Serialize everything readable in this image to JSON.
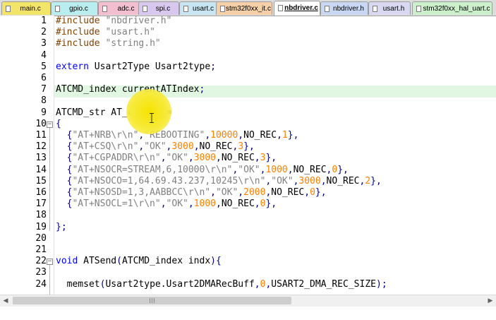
{
  "tabs": [
    {
      "label": "main.c",
      "color": "#f3e46a",
      "active": false
    },
    {
      "label": "gpio.c",
      "color": "#b9eef0",
      "active": false
    },
    {
      "label": "adc.c",
      "color": "#f2bfd0",
      "active": false
    },
    {
      "label": "spi.c",
      "color": "#d8c8f0",
      "active": false
    },
    {
      "label": "usart.c",
      "color": "#c8e6f2",
      "active": false
    },
    {
      "label": "stm32f0xx_it.c",
      "color": "#f5cfa8",
      "active": false
    },
    {
      "label": "nbdriver.c",
      "color": "#ffffff",
      "active": true
    },
    {
      "label": "nbdriver.h",
      "color": "#c8d8f2",
      "active": false
    },
    {
      "label": "usart.h",
      "color": "#d8d8f2",
      "active": false
    },
    {
      "label": "stm32f0xx_hal_uart.c",
      "color": "#ccf0cc",
      "active": false
    }
  ],
  "editor": {
    "current_line": 7,
    "line_numbers": [
      "1",
      "2",
      "3",
      "4",
      "5",
      "6",
      "7",
      "8",
      "9",
      "10",
      "11",
      "12",
      "13",
      "14",
      "15",
      "16",
      "17",
      "18",
      "19",
      "20",
      "21",
      "22",
      "23",
      "24"
    ],
    "lines": [
      "#include \"nbdriver.h\"",
      "#include \"usart.h\"",
      "#include \"string.h\"",
      "",
      "extern Usart2Type Usart2type;",
      "",
      "ATCMD_index currentATIndex;",
      "",
      "ATCMD_str AT_cmds[] =",
      "{",
      "  {\"AT+NRB\\r\\n\",\"REBOOTING\",10000,NO_REC,1},",
      "  {\"AT+CSQ\\r\\n\",\"OK\",3000,NO_REC,3},",
      "  {\"AT+CGPADDR\\r\\n\",\"OK\",3000,NO_REC,3},",
      "  {\"AT+NSOCR=STREAM,6,10000\\r\\n\",\"OK\",1000,NO_REC,0},",
      "  {\"AT+NSOCO=1,64.69.43.237,10245\\r\\n\",\"OK\",3000,NO_REC,2},",
      "  {\"AT+NSOSD=1,3,AABBCC\\r\\n\",\"OK\",2000,NO_REC,0},",
      "  {\"AT+NSOCL=1\\r\\n\",\"OK\",1000,NO_REC,0},",
      "",
      "};",
      "",
      "",
      "void ATSend(ATCMD_index indx){",
      "",
      "  memset(Usart2type.Usart2DMARecBuff,0,USART2_DMA_REC_SIZE);"
    ]
  },
  "icons": {
    "fold_open": "minus-box-icon",
    "scroll_left": "arrow-left-icon",
    "scroll_right": "arrow-right-icon",
    "cursor": "ibeam-cursor-icon"
  }
}
